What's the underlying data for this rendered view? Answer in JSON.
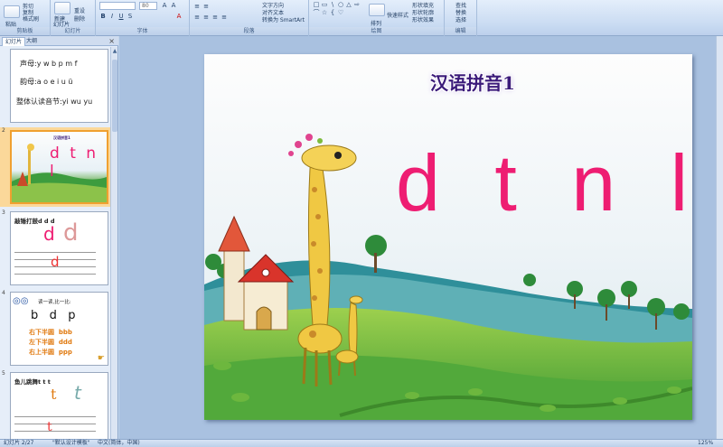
{
  "ribbon": {
    "clipboard": {
      "paste": "粘贴",
      "cut": "剪切",
      "copy": "复制",
      "format_painter": "格式刷",
      "label": "剪贴板"
    },
    "slides": {
      "new_slide": "新建",
      "new_slide2": "幻灯片",
      "reset": "重设",
      "delete": "删除",
      "label": "幻灯片"
    },
    "font": {
      "size": "80",
      "label": "字体"
    },
    "paragraph": {
      "text_direction": "文字方向",
      "align_text": "对齐文本",
      "smartart": "转换为 SmartArt",
      "label": "段落"
    },
    "drawing": {
      "arrange": "排列",
      "quick_styles": "快速样式",
      "shape_fill": "形状填充",
      "shape_outline": "形状轮廓",
      "shape_effects": "形状效果",
      "label": "绘图"
    },
    "editing": {
      "find": "查找",
      "replace": "替换",
      "select": "选择",
      "label": "编辑"
    }
  },
  "panel": {
    "tab_slides": "幻灯片",
    "tab_outline": "大纲",
    "close": "×"
  },
  "thumbnails": [
    {
      "num": "",
      "lines": [
        "声母:y w b p m f",
        "韵母:a o e i u ü",
        "整体认读音节:yi wu yu"
      ]
    },
    {
      "num": "2",
      "title": "汉语拼音1",
      "letters": "d t n l"
    },
    {
      "num": "3",
      "title": "敲锤打鼓d d d",
      "big": "d",
      "small": "d"
    },
    {
      "num": "4",
      "title": "读一读,比一比:",
      "row": "b   d   p",
      "lines": [
        "右下半圆  bbb",
        "左下半圆  ddd",
        "右上半圆  ppp"
      ]
    },
    {
      "num": "5",
      "title": "鱼儿跳舞t t t",
      "big": "t",
      "small": "t"
    }
  ],
  "slide": {
    "title": "汉语拼音1",
    "letters": "d t n l"
  },
  "status": {
    "slide_info": "幻灯片 2/27",
    "theme": "\"默认设计模板\"",
    "language": "中文(简体，中国)",
    "zoom": "125%"
  },
  "colors": {
    "accent": "#ee1d72",
    "title": "#3b1a7a",
    "ribbon": "#c9dbf2"
  }
}
